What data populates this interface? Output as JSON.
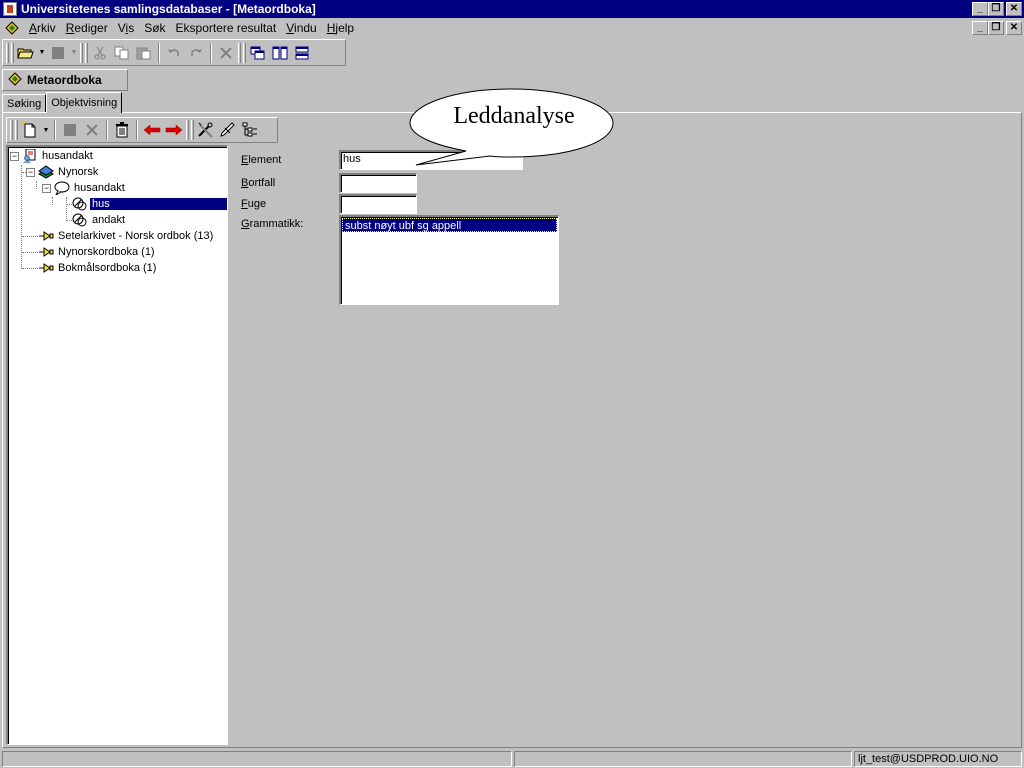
{
  "titlebar": {
    "title": "Universitetenes samlingsdatabaser - [Metaordboka]",
    "minimize": "_",
    "restore": "❐",
    "close": "✕"
  },
  "menubar": {
    "items": [
      "Arkiv",
      "Rediger",
      "Vis",
      "Søk",
      "Eksportere resultat",
      "Vindu",
      "Hjelp"
    ],
    "mnemonics": [
      "A",
      "R",
      "i",
      "",
      "",
      "V",
      "H"
    ],
    "mdi_minimize": "_",
    "mdi_restore": "❐",
    "mdi_close": "✕"
  },
  "toolbar1": {
    "buttons": [
      "open-folder",
      "dropdown",
      "save",
      "dropdown",
      "cut",
      "copy",
      "paste",
      "undo",
      "redo",
      "delete",
      "cascade-windows",
      "tile-vertical",
      "tile-horizontal"
    ]
  },
  "doc_header": {
    "title": "Metaordboka"
  },
  "tabs": [
    {
      "label": "Søking",
      "active": false
    },
    {
      "label": "Objektvisning",
      "active": true
    }
  ],
  "toolbar2": {
    "buttons": [
      "new-document",
      "dropdown",
      "stop",
      "cancel",
      "trash",
      "arrow-left",
      "arrow-right",
      "tools-pencil",
      "edit",
      "hierarchy"
    ]
  },
  "tree": {
    "nodes": [
      {
        "label": "husandakt",
        "level": 0,
        "expander": "−",
        "icon": "document-person-icon"
      },
      {
        "label": "Nynorsk",
        "level": 1,
        "expander": "−",
        "icon": "books-icon"
      },
      {
        "label": "husandakt",
        "level": 2,
        "expander": "−",
        "icon": "speech-bubble-icon"
      },
      {
        "label": "hus",
        "level": 3,
        "expander": "",
        "icon": "chain-link-icon",
        "selected": true
      },
      {
        "label": "andakt",
        "level": 3,
        "expander": "",
        "icon": "chain-link-icon"
      },
      {
        "label": "Setelarkivet - Norsk ordbok (13)",
        "level": 1,
        "expander": "",
        "icon": "key-arrow-icon"
      },
      {
        "label": "Nynorskordboka (1)",
        "level": 1,
        "expander": "",
        "icon": "key-arrow-icon"
      },
      {
        "label": "Bokmålsordboka (1)",
        "level": 1,
        "expander": "",
        "icon": "key-arrow-icon"
      }
    ]
  },
  "form": {
    "element": {
      "label": "Element",
      "mnemonic": "E",
      "rest": "lement",
      "value": "hus"
    },
    "bortfall": {
      "label": "Bortfall",
      "mnemonic": "B",
      "rest": "ortfall",
      "value": ""
    },
    "fuge": {
      "label": "Fuge",
      "mnemonic": "F",
      "rest": "uge",
      "value": ""
    },
    "grammatikk": {
      "label": "Grammatikk:",
      "mnemonic": "G",
      "rest": "rammatikk:",
      "items": [
        "subst nøyt ubf sg appell"
      ],
      "selected_index": 0
    }
  },
  "bubble": {
    "text": "Leddanalyse"
  },
  "statusbar": {
    "panels": [
      "",
      "",
      "ljt_test@USDPROD.UIO.NO"
    ]
  },
  "colors": {
    "titlebar": "#000080",
    "face": "#c0c0c0",
    "selection": "#000080",
    "window": "#ffffff"
  }
}
